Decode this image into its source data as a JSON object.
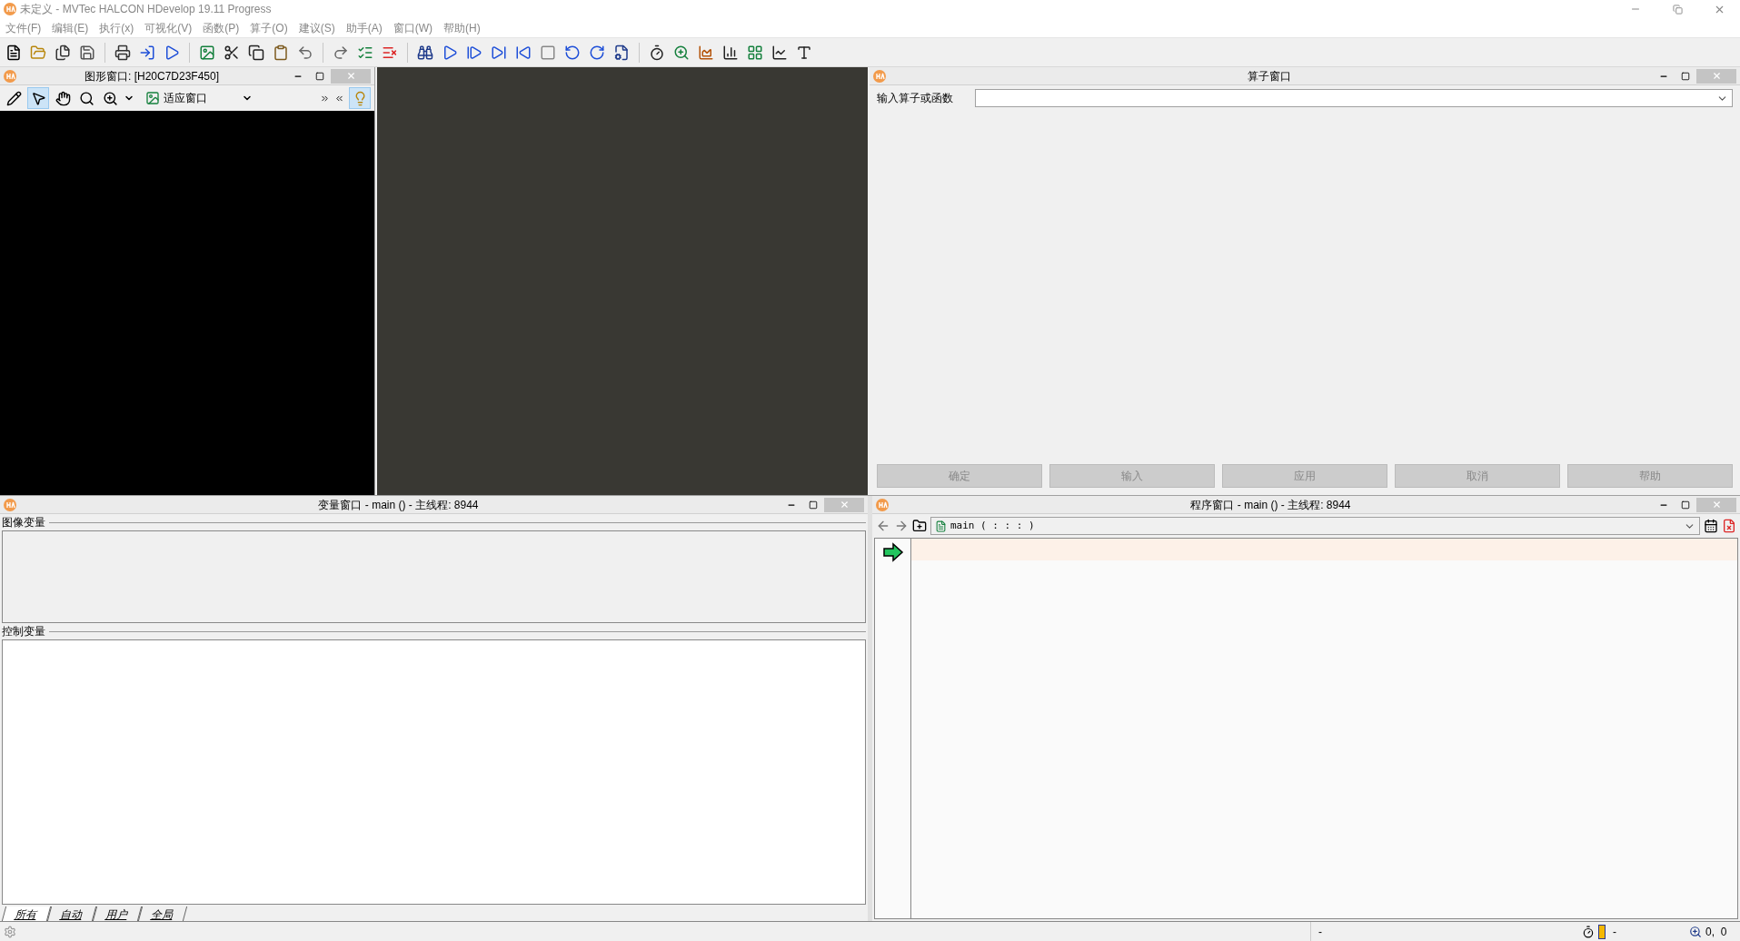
{
  "window": {
    "title": "未定义 - MVTec HALCON HDevelop 19.11 Progress"
  },
  "menu": [
    "文件(F)",
    "编辑(E)",
    "执行(x)",
    "可视化(V)",
    "函数(P)",
    "算子(O)",
    "建议(S)",
    "助手(A)",
    "窗口(W)",
    "帮助(H)"
  ],
  "graphics_window": {
    "title": "图形窗口: [H20C7D23F450]",
    "zoom_mode": "适应窗口"
  },
  "operator_window": {
    "title": "算子窗口",
    "label": "输入算子或函数",
    "buttons": [
      {
        "label": "确定",
        "disabled": true
      },
      {
        "label": "输入",
        "disabled": true
      },
      {
        "label": "应用",
        "disabled": true
      },
      {
        "label": "取消",
        "disabled": true
      },
      {
        "label": "帮助",
        "disabled": true
      }
    ]
  },
  "variable_window": {
    "title": "变量窗口 - main () - 主线程: 8944",
    "sections": [
      "图像变量",
      "控制变量"
    ],
    "tabs": [
      {
        "label": "所有",
        "selected": true
      },
      {
        "label": "自动",
        "selected": false
      },
      {
        "label": "用户",
        "selected": false
      },
      {
        "label": "全局",
        "selected": false
      }
    ]
  },
  "program_window": {
    "title": "程序窗口 - main () - 主线程: 8944",
    "procedure": "main ( : : : )"
  },
  "status_bar": {
    "message": "-",
    "time": "-",
    "coords": "0,  0"
  }
}
